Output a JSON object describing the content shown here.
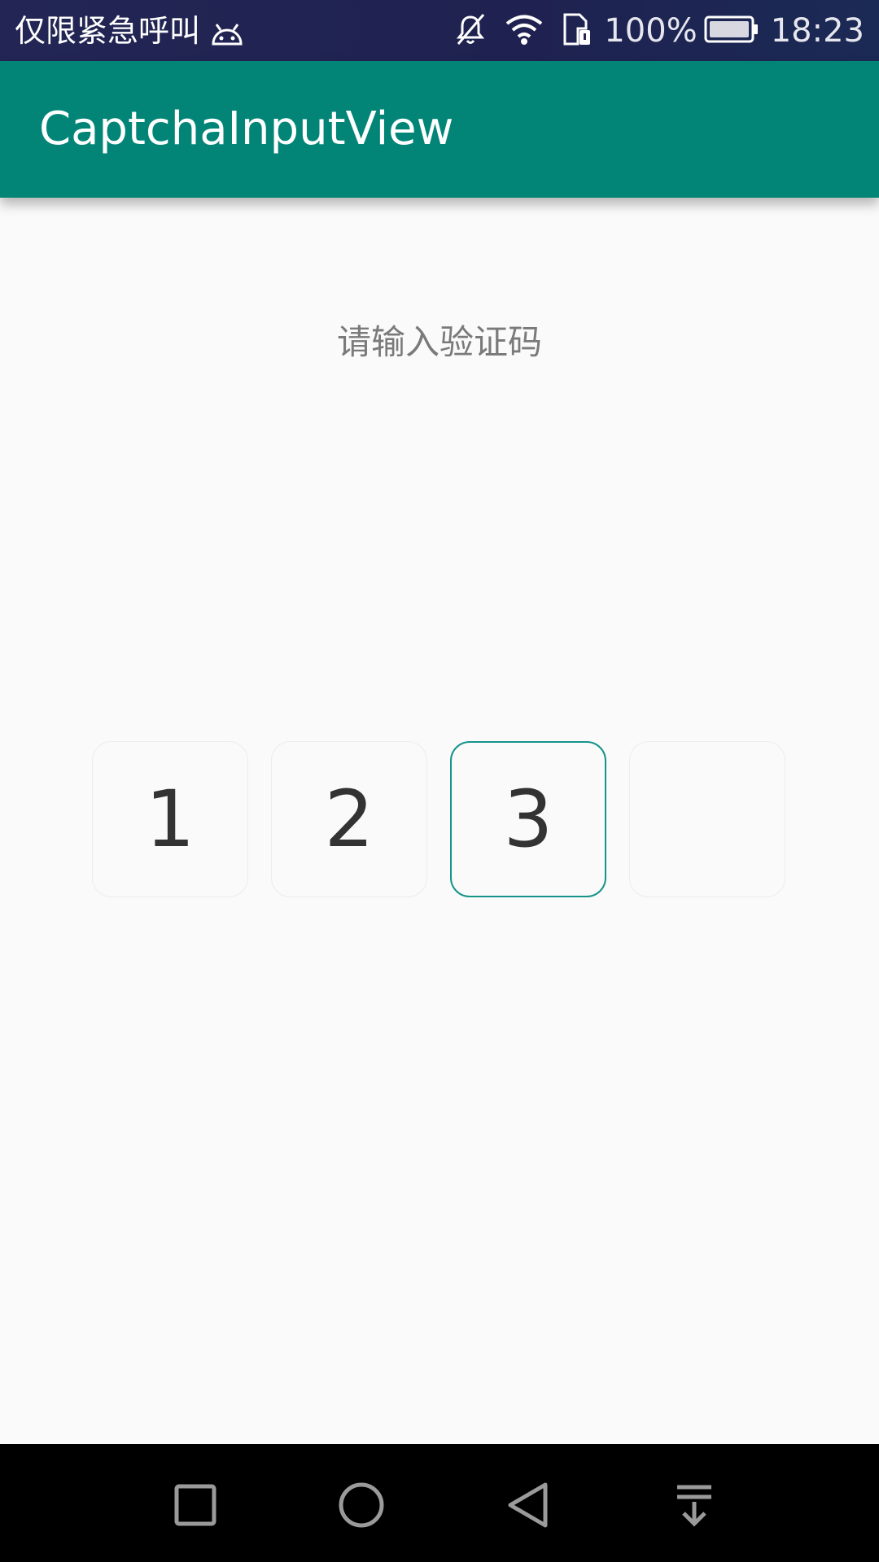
{
  "status_bar": {
    "carrier_text": "仅限紧急呼叫",
    "battery": "100%",
    "time": "18:23",
    "icons": [
      "android-debug-icon",
      "mute-icon",
      "wifi-icon",
      "sim-icon",
      "battery-icon"
    ]
  },
  "app_bar": {
    "title": "CaptchaInputView",
    "color": "#028577"
  },
  "main": {
    "prompt": "请输入验证码",
    "code_boxes": [
      {
        "value": "1",
        "active": false
      },
      {
        "value": "2",
        "active": false
      },
      {
        "value": "3",
        "active": true
      },
      {
        "value": "",
        "active": false
      }
    ],
    "accent_color": "#16948a"
  },
  "nav_bar": {
    "buttons": [
      "recent-apps-icon",
      "home-icon",
      "back-icon",
      "notification-pull-icon"
    ]
  }
}
